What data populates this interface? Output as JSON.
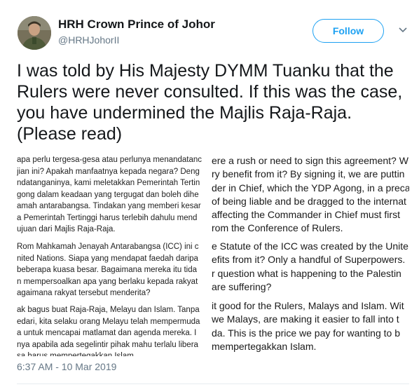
{
  "profile": {
    "display_name": "HRH Crown Prince of Johor",
    "handle": "@HRHJohorII",
    "follow_label": "Follow"
  },
  "tweet": {
    "text": "I was told by His Majesty DYMM Tuanku that the Rulers were never consulted. If this was the case, you have undermined the Majlis Raja-Raja. (Please read)",
    "timestamp": "6:37 AM - 10 Mar 2019"
  },
  "image": {
    "malay_paragraphs": [
      [
        "apa perlu tergesa-gesa atau perlunya menandatanc",
        "jian ini? Apakah manfaatnya kepada negara? Deng",
        "ndatanganinya, kami meletakkan Pemerintah Tertin",
        "gong dalam keadaan yang tergugat dan boleh dihe",
        "amah antarabangsa. Tindakan yang memberi kesar",
        "a Pemerintah Tertinggi harus terlebih dahulu mend",
        "ujuan dari Majlis Raja-Raja."
      ],
      [
        "Rom Mahkamah Jenayah Antarabangsa (ICC) ini c",
        "nited Nations. Siapa yang mendapat faedah daripa",
        "beberapa kuasa besar. Bagaimana mereka itu tida",
        "n mempersoalkan apa yang berlaku kepada rakyat",
        "agaimana rakyat tersebut menderita?"
      ],
      [
        "ak bagus buat Raja-Raja, Melayu dan Islam. Tanpa",
        "edari, kita selaku orang Melayu telah mempermuda",
        "a untuk mencapai matlamat dan agenda mereka. I",
        "nya apabila ada segelintir pihak mahu terlalu libera",
        "sa harus mempertegakkan Islam."
      ]
    ],
    "english_paragraphs": [
      [
        "ere a rush or need to sign this agreement? W",
        "ry benefit from it? By signing it, we are puttin",
        "der in Chief, which the YDP Agong, in a preca",
        "of being liable and be dragged to the internat",
        "affecting the Commander in Chief must first",
        "rom the Conference of Rulers."
      ],
      [
        "e Statute of the ICC was created by the Unite",
        "efits from it? Only a handful of Superpowers.",
        "r question what is happening to the Palestin",
        "are suffering?"
      ],
      [
        "it good for the Rulers, Malays and Islam. Wit",
        "we Malays, are making it easier to fall into t",
        "da. This is the price we pay for wanting to b",
        "mempertegakkan Islam."
      ]
    ]
  }
}
